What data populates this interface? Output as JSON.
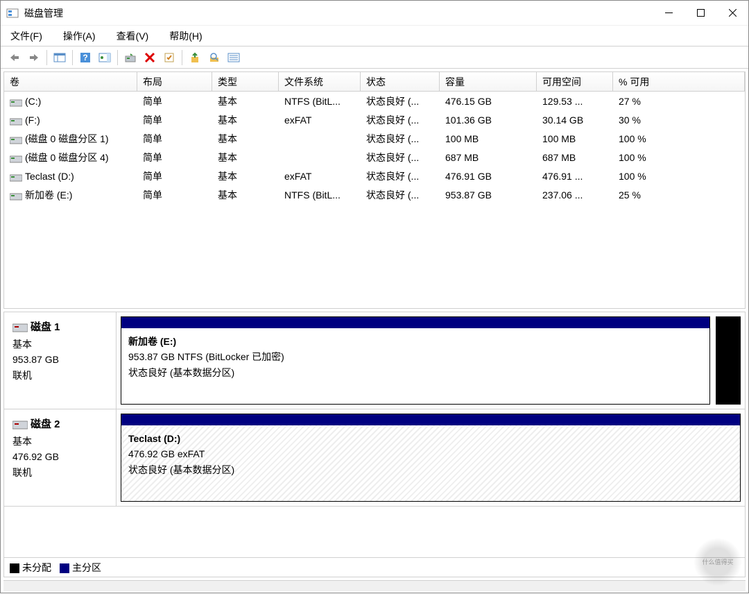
{
  "window": {
    "title": "磁盘管理"
  },
  "menubar": {
    "file": "文件(F)",
    "action": "操作(A)",
    "view": "查看(V)",
    "help": "帮助(H)"
  },
  "table": {
    "headers": {
      "volume": "卷",
      "layout": "布局",
      "type": "类型",
      "filesystem": "文件系统",
      "status": "状态",
      "capacity": "容量",
      "free": "可用空间",
      "pct": "% 可用"
    },
    "rows": [
      {
        "volume": "(C:)",
        "layout": "简单",
        "type": "基本",
        "fs": "NTFS (BitL...",
        "status": "状态良好 (...",
        "capacity": "476.15 GB",
        "free": "129.53 ...",
        "pct": "27 %"
      },
      {
        "volume": "(F:)",
        "layout": "简单",
        "type": "基本",
        "fs": "exFAT",
        "status": "状态良好 (...",
        "capacity": "101.36 GB",
        "free": "30.14 GB",
        "pct": "30 %"
      },
      {
        "volume": "(磁盘 0 磁盘分区 1)",
        "layout": "简单",
        "type": "基本",
        "fs": "",
        "status": "状态良好 (...",
        "capacity": "100 MB",
        "free": "100 MB",
        "pct": "100 %"
      },
      {
        "volume": "(磁盘 0 磁盘分区 4)",
        "layout": "简单",
        "type": "基本",
        "fs": "",
        "status": "状态良好 (...",
        "capacity": "687 MB",
        "free": "687 MB",
        "pct": "100 %"
      },
      {
        "volume": "Teclast (D:)",
        "layout": "简单",
        "type": "基本",
        "fs": "exFAT",
        "status": "状态良好 (...",
        "capacity": "476.91 GB",
        "free": "476.91 ...",
        "pct": "100 %"
      },
      {
        "volume": "新加卷 (E:)",
        "layout": "简单",
        "type": "基本",
        "fs": "NTFS (BitL...",
        "status": "状态良好 (...",
        "capacity": "953.87 GB",
        "free": "237.06 ...",
        "pct": "25 %"
      }
    ]
  },
  "disks": [
    {
      "name": "磁盘 1",
      "type": "基本",
      "size": "953.87 GB",
      "status": "联机",
      "partitions": [
        {
          "name": "新加卷  (E:)",
          "detail": "953.87 GB NTFS (BitLocker 已加密)",
          "state": "状态良好 (基本数据分区)",
          "hatched": false,
          "unalloc_after": true
        }
      ]
    },
    {
      "name": "磁盘 2",
      "type": "基本",
      "size": "476.92 GB",
      "status": "联机",
      "partitions": [
        {
          "name": "Teclast  (D:)",
          "detail": "476.92 GB exFAT",
          "state": "状态良好 (基本数据分区)",
          "hatched": true,
          "unalloc_after": false
        }
      ]
    }
  ],
  "legend": {
    "unallocated": "未分配",
    "primary": "主分区"
  },
  "watermark": "什么值得买"
}
